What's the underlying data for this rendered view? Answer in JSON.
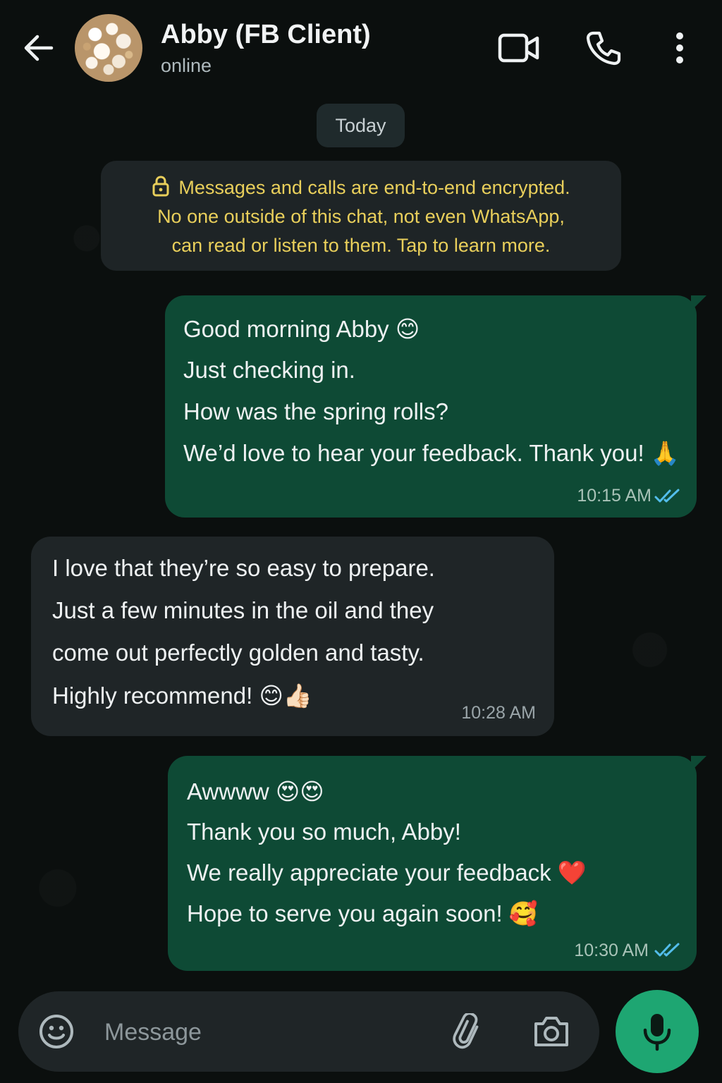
{
  "header": {
    "contact_name": "Abby (FB Client)",
    "status": "online",
    "icons": [
      "back-arrow-icon",
      "video-call-icon",
      "phone-icon",
      "more-options-icon"
    ]
  },
  "date_chip": "Today",
  "encryption_notice": {
    "lines": [
      "Messages and calls are end-to-end encrypted.",
      "No one outside of this chat, not even WhatsApp,",
      "can read or listen to them. Tap to learn more."
    ],
    "icon": "lock-icon"
  },
  "messages": [
    {
      "direction": "outgoing",
      "lines": [
        "Good morning Abby 😊",
        "Just checking in.",
        "How was the spring rolls?",
        "We’d love to hear your feedback. Thank you! 🙏"
      ],
      "time": "10:15 AM",
      "status": "read"
    },
    {
      "direction": "incoming",
      "lines": [
        "I love that they’re so easy to prepare.",
        "Just a few minutes in the oil and they",
        "come out perfectly golden and tasty.",
        "Highly recommend! 😊👍🏻"
      ],
      "time": "10:28 AM"
    },
    {
      "direction": "outgoing",
      "lines": [
        "Awwww 😍😍",
        "Thank you so much, Abby!",
        "We really appreciate your feedback ❤️",
        "Hope to serve you again soon! 🥰"
      ],
      "time": "10:30 AM",
      "status": "read"
    }
  ],
  "composer": {
    "placeholder": "Message",
    "icons": [
      "emoji-icon",
      "attachment-icon",
      "camera-icon",
      "microphone-icon"
    ]
  },
  "colors": {
    "background": "#0b0f0e",
    "outgoing_bubble": "#0e4a35",
    "incoming_bubble": "#1f2527",
    "encryption_text": "#e9cf5b",
    "read_ticks": "#53bdeb",
    "mic_button": "#1ea672"
  }
}
